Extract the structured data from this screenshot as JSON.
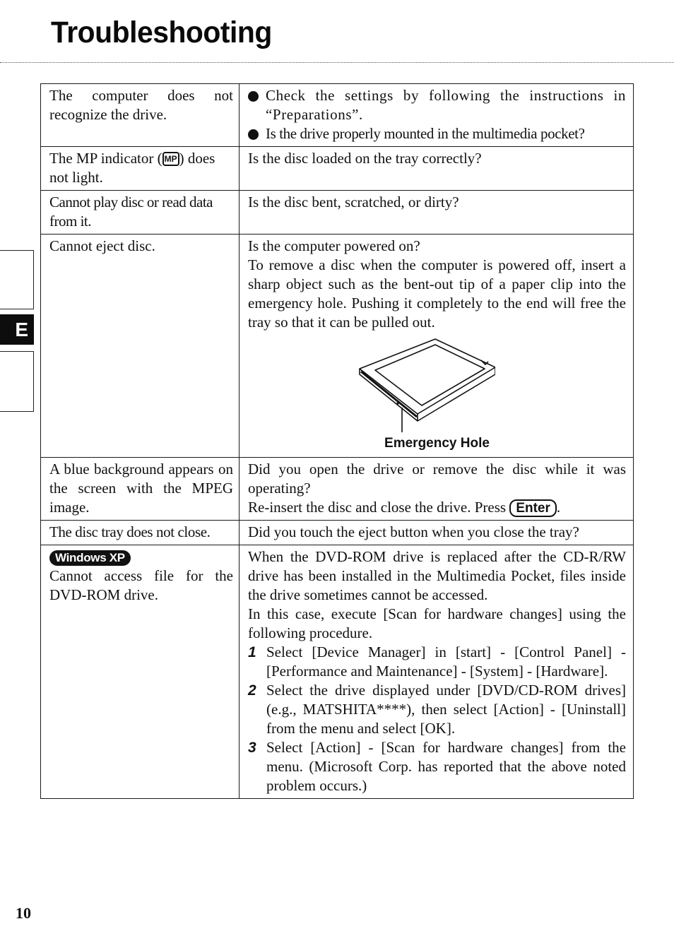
{
  "page": {
    "title": "Troubleshooting",
    "section_tab": "E",
    "page_number": "10"
  },
  "table": {
    "rows": [
      {
        "symptom": "The computer does not recognize the drive.",
        "remedy_bullets": [
          "Check the settings by following the instructions in “Preparations”.",
          "Is the drive properly mounted in the multimedia pocket?"
        ]
      },
      {
        "symptom_before_icon": "The MP indicator (",
        "symptom_icon": "MP",
        "symptom_after_icon": ") does not light.",
        "remedy": "Is the disc loaded on the tray correctly?"
      },
      {
        "symptom": "Cannot play disc or read data from it.",
        "remedy": "Is the disc bent, scratched, or dirty?"
      },
      {
        "symptom": "Cannot eject disc.",
        "remedy_lines": [
          "Is the computer powered on?",
          "To remove a disc when the computer is powered off, insert a sharp object such as the bent-out tip of a paper clip into the emergency hole. Pushing it completely to the end will free the tray so that it can be pulled out."
        ],
        "figure_caption": "Emergency Hole"
      },
      {
        "symptom": "A blue background appears on the screen with the MPEG image.",
        "remedy_lines": [
          "Did you open the drive or remove the disc while it was operating?",
          "Re-insert the disc and close the drive. Press"
        ],
        "key": "Enter",
        "key_suffix": "."
      },
      {
        "symptom": "The disc tray does not close.",
        "remedy": "Did you touch the eject button when you close the tray?"
      },
      {
        "badge": "Windows XP",
        "symptom": "Cannot access file for the DVD-ROM drive.",
        "remedy_lines": [
          "When the DVD-ROM drive is replaced after the CD-R/RW drive has been installed in the Multimedia Pocket, files inside the drive sometimes cannot be accessed.",
          "In this case, execute [Scan for hardware changes] using the following procedure."
        ],
        "steps": [
          {
            "num": "1",
            "text": "Select [Device Manager] in [start] - [Control Panel] - [Performance and Maintenance] - [System] - [Hardware]."
          },
          {
            "num": "2",
            "text": "Select the drive displayed under [DVD/CD-ROM drives] (e.g., MATSHITA****), then select [Action] - [Uninstall] from the menu and select [OK]."
          },
          {
            "num": "3",
            "text": "Select [Action] - [Scan for hardware changes] from the menu. (Microsoft Corp. has reported that the above noted problem occurs.)"
          }
        ]
      }
    ]
  }
}
